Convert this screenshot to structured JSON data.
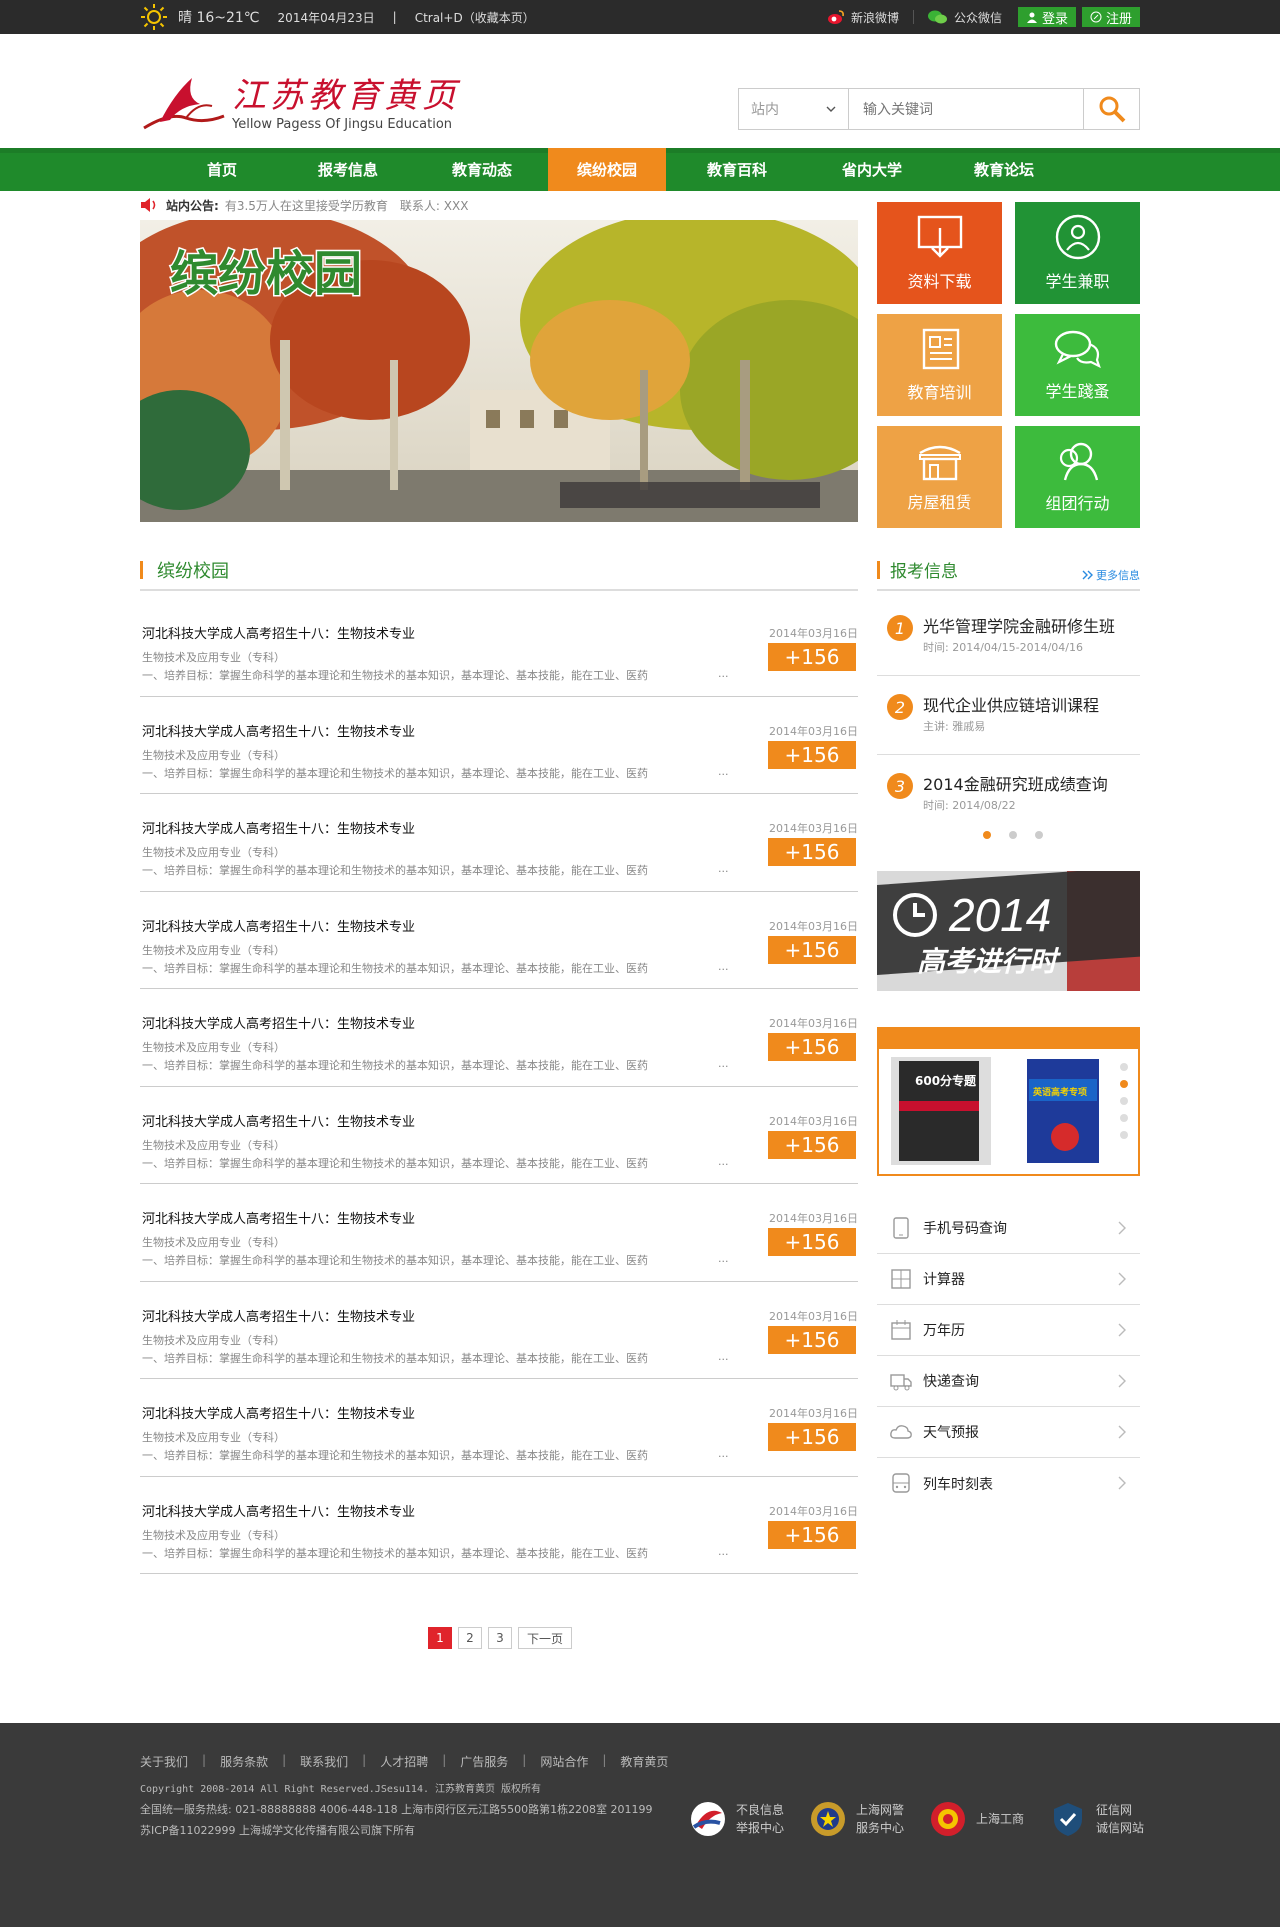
{
  "topbar": {
    "weather": "晴 16~21℃",
    "date": "2014年04月23日",
    "bookmark": "Ctral+D（收藏本页）",
    "weibo": "新浪微博",
    "wechat": "公众微信",
    "login": "登录",
    "register": "注册",
    "divider": "|"
  },
  "header": {
    "logo_cn": "江苏教育黄页",
    "logo_en": "Yellow Pagess Of Jingsu Education",
    "search_scope": "站内",
    "search_placeholder": "输入关键词"
  },
  "nav": [
    {
      "label": "首页"
    },
    {
      "label": "报考信息"
    },
    {
      "label": "教育动态"
    },
    {
      "label": "缤纷校园"
    },
    {
      "label": "教育百科"
    },
    {
      "label": "省内大学"
    },
    {
      "label": "教育论坛"
    }
  ],
  "notice": {
    "label": "站内公告:",
    "text": "有3.5万人在这里接受学历教育",
    "contact": "联系人: XXX"
  },
  "banner": {
    "title": "缤纷校园"
  },
  "tiles": [
    {
      "label": "资料下载",
      "icon": "download-icon",
      "color": "#e5541c"
    },
    {
      "label": "学生兼职",
      "icon": "user-icon",
      "color": "#219335"
    },
    {
      "label": "教育培训",
      "icon": "newspaper-icon",
      "color": "#eea245"
    },
    {
      "label": "学生踐蚤",
      "icon": "chat-icon",
      "color": "#3dbb3d"
    },
    {
      "label": "房屋租赁",
      "icon": "shop-icon",
      "color": "#eea245"
    },
    {
      "label": "组团行动",
      "icon": "group-icon",
      "color": "#3dbb3d"
    }
  ],
  "main_section": {
    "title": "缤纷校园"
  },
  "list": [
    {
      "title": "河北科技大学成人高考招生十八：生物技术专业",
      "sub": "生物技术及应用专业（专科）",
      "desc": "一、培养目标：掌握生命科学的基本理论和生物技术的基本知识，基本理论、基本技能，能在工业、医药",
      "dots": "...",
      "date": "2014年03月16日",
      "count": "+156"
    },
    {
      "title": "河北科技大学成人高考招生十八：生物技术专业",
      "sub": "生物技术及应用专业（专科）",
      "desc": "一、培养目标：掌握生命科学的基本理论和生物技术的基本知识，基本理论、基本技能，能在工业、医药",
      "dots": "...",
      "date": "2014年03月16日",
      "count": "+156"
    },
    {
      "title": "河北科技大学成人高考招生十八：生物技术专业",
      "sub": "生物技术及应用专业（专科）",
      "desc": "一、培养目标：掌握生命科学的基本理论和生物技术的基本知识，基本理论、基本技能，能在工业、医药",
      "dots": "...",
      "date": "2014年03月16日",
      "count": "+156"
    },
    {
      "title": "河北科技大学成人高考招生十八：生物技术专业",
      "sub": "生物技术及应用专业（专科）",
      "desc": "一、培养目标：掌握生命科学的基本理论和生物技术的基本知识，基本理论、基本技能，能在工业、医药",
      "dots": "...",
      "date": "2014年03月16日",
      "count": "+156"
    },
    {
      "title": "河北科技大学成人高考招生十八：生物技术专业",
      "sub": "生物技术及应用专业（专科）",
      "desc": "一、培养目标：掌握生命科学的基本理论和生物技术的基本知识，基本理论、基本技能，能在工业、医药",
      "dots": "...",
      "date": "2014年03月16日",
      "count": "+156"
    },
    {
      "title": "河北科技大学成人高考招生十八：生物技术专业",
      "sub": "生物技术及应用专业（专科）",
      "desc": "一、培养目标：掌握生命科学的基本理论和生物技术的基本知识，基本理论、基本技能，能在工业、医药",
      "dots": "...",
      "date": "2014年03月16日",
      "count": "+156"
    },
    {
      "title": "河北科技大学成人高考招生十八：生物技术专业",
      "sub": "生物技术及应用专业（专科）",
      "desc": "一、培养目标：掌握生命科学的基本理论和生物技术的基本知识，基本理论、基本技能，能在工业、医药",
      "dots": "...",
      "date": "2014年03月16日",
      "count": "+156"
    },
    {
      "title": "河北科技大学成人高考招生十八：生物技术专业",
      "sub": "生物技术及应用专业（专科）",
      "desc": "一、培养目标：掌握生命科学的基本理论和生物技术的基本知识，基本理论、基本技能，能在工业、医药",
      "dots": "...",
      "date": "2014年03月16日",
      "count": "+156"
    },
    {
      "title": "河北科技大学成人高考招生十八：生物技术专业",
      "sub": "生物技术及应用专业（专科）",
      "desc": "一、培养目标：掌握生命科学的基本理论和生物技术的基本知识，基本理论、基本技能，能在工业、医药",
      "dots": "...",
      "date": "2014年03月16日",
      "count": "+156"
    },
    {
      "title": "河北科技大学成人高考招生十八：生物技术专业",
      "sub": "生物技术及应用专业（专科）",
      "desc": "一、培养目标：掌握生命科学的基本理论和生物技术的基本知识，基本理论、基本技能，能在工业、医药",
      "dots": "...",
      "date": "2014年03月16日",
      "count": "+156"
    }
  ],
  "pager": {
    "pages": [
      "1",
      "2",
      "3"
    ],
    "current": "1",
    "next": "下一页"
  },
  "exam": {
    "title": "报考信息",
    "more": "更多信息",
    "items": [
      {
        "num": "1",
        "title": "光华管理学院金融研修生班",
        "sub": "时间: 2014/04/15-2014/04/16"
      },
      {
        "num": "2",
        "title": "现代企业供应链培训课程",
        "sub": "主讲: 雅戚易"
      },
      {
        "num": "3",
        "title": "2014金融研究班成绩查询",
        "sub": "时间: 2014/08/22"
      }
    ]
  },
  "ad": {
    "year": "2014",
    "text": "高考进行时"
  },
  "books": [
    {
      "title": "600分专题"
    },
    {
      "title": "英语高考专项"
    }
  ],
  "tools": [
    {
      "label": "手机号码查询",
      "icon": "phone-icon"
    },
    {
      "label": "计算器",
      "icon": "calculator-icon"
    },
    {
      "label": "万年历",
      "icon": "calendar-icon"
    },
    {
      "label": "快递查询",
      "icon": "truck-icon"
    },
    {
      "label": "天气预报",
      "icon": "cloud-icon"
    },
    {
      "label": "列车时刻表",
      "icon": "train-icon"
    }
  ],
  "footer": {
    "links": [
      "关于我们",
      "服务条款",
      "联系我们",
      "人才招聘",
      "广告服务",
      "网站合作",
      "教育黄页"
    ],
    "separator": "|",
    "copyright": "Copyright 2008-2014 All Right Reserved.JSesu114. 江苏教育黄页 版权所有",
    "hotline": "全国统一服务热线: 021-88888888 4006-448-118   上海市闵行区元江路5500路第1栋2208室  201199",
    "icp": "苏ICP备11022999   上海城学文化传播有限公司旗下所有",
    "badges": [
      {
        "line1": "不良信息",
        "line2": "举报中心"
      },
      {
        "line1": "上海网警",
        "line2": "服务中心"
      },
      {
        "line1": "上海工商",
        "line2": ""
      },
      {
        "line1": "征信网",
        "line2": "诚信网站"
      }
    ]
  }
}
